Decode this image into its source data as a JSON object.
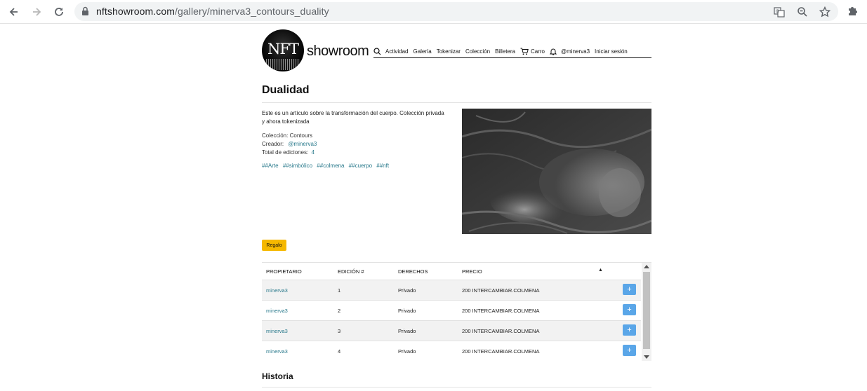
{
  "browser": {
    "url_host": "nftshowroom.com",
    "url_path": "/gallery/minerva3_contours_duality",
    "icons": [
      "back-icon",
      "forward-icon",
      "reload-icon",
      "lock-icon",
      "translate-icon",
      "zoom-icon",
      "star-icon",
      "extensions-icon"
    ]
  },
  "site": {
    "logo_badge": "NFT",
    "logo_word": "showroom",
    "nav": {
      "actividad": "Actividad",
      "galeria": "Galería",
      "tokenizar": "Tokenizar",
      "coleccion": "Colección",
      "billetera": "Billetera",
      "carro": "Carro",
      "user": "@minerva3",
      "login": "Iniciar sesión"
    }
  },
  "artwork": {
    "title": "Dualidad",
    "description": "Este es un artículo sobre la transformación del cuerpo. Colección privada y ahora tokenizada",
    "collection_label": "Colección:",
    "collection_value": "Contours",
    "creator_label": "Creador:",
    "creator_value": "@minerva3",
    "editions_label": "Total de ediciones:",
    "editions_value": "4",
    "tags": [
      "##Arte",
      "##simbólico",
      "##colmena",
      "##cuerpo",
      "##nft"
    ],
    "gift_button": "Regalo"
  },
  "editions_table": {
    "headers": {
      "owner": "PROPIETARIO",
      "edition": "EDICIÓN #",
      "rights": "DERECHOS",
      "price": "PRECIO"
    },
    "rows": [
      {
        "owner": "minerva3",
        "edition": "1",
        "rights": "Privado",
        "price": "200 INTERCAMBIAR.COLMENA",
        "action": "+"
      },
      {
        "owner": "minerva3",
        "edition": "2",
        "rights": "Privado",
        "price": "200 INTERCAMBIAR.COLMENA",
        "action": "+"
      },
      {
        "owner": "minerva3",
        "edition": "3",
        "rights": "Privado",
        "price": "200 INTERCAMBIAR.COLMENA",
        "action": "+"
      },
      {
        "owner": "minerva3",
        "edition": "4",
        "rights": "Privado",
        "price": "200 INTERCAMBIAR.COLMENA",
        "action": "+"
      }
    ]
  },
  "history_title": "Historia",
  "colors": {
    "link": "#2a7a8c",
    "gift_button": "#f5b800",
    "plus_button": "#5aa6e8"
  }
}
